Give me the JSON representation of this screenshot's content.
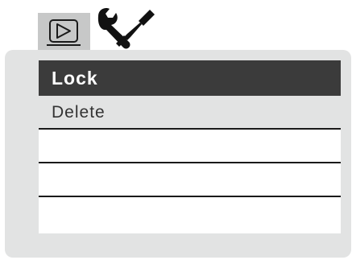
{
  "tabs": [
    {
      "icon": "play-icon",
      "selected": true
    },
    {
      "icon": "settings-tools-icon",
      "selected": false
    }
  ],
  "menu": {
    "items": [
      {
        "label": "Lock",
        "selected": true
      },
      {
        "label": "Delete",
        "selected": false
      },
      {
        "label": ""
      },
      {
        "label": ""
      },
      {
        "label": ""
      }
    ]
  },
  "colors": {
    "selected_tab_bg": "#c7c8c8",
    "panel_bg": "#e2e3e3",
    "selected_item_bg": "#3b3b3b",
    "selected_item_text": "#ffffff",
    "item_text": "#333333",
    "divider": "#1a1a1a"
  }
}
